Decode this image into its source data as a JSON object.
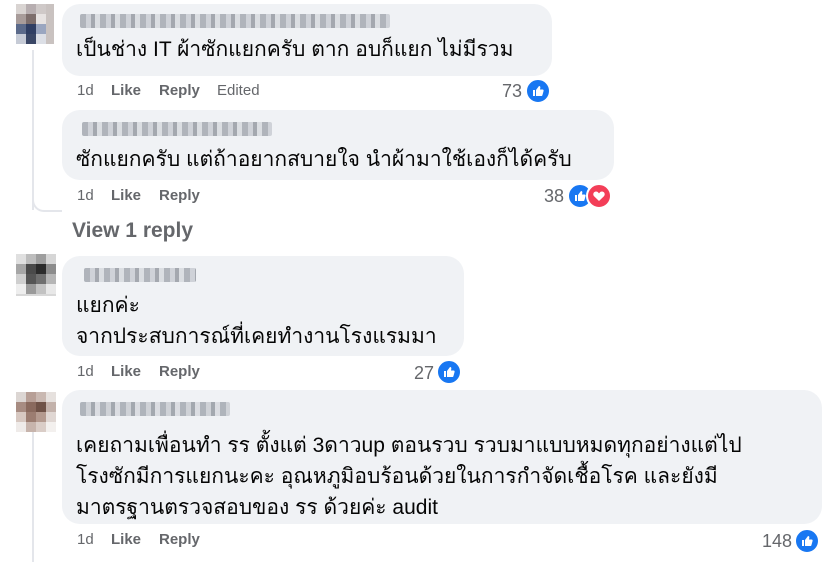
{
  "comments": [
    {
      "text": "เป็นช่าง IT ผ้าซักแยกครับ ตาก อบก็แยก ไม่มีรวม",
      "time": "1d",
      "like": "Like",
      "reply": "Reply",
      "edited": "Edited",
      "count": "73",
      "reactions": [
        "like-icon"
      ]
    },
    {
      "text": "ซักแยกครับ แต่ถ้าอยากสบายใจ นำผ้ามาใช้เองก็ได้ครับ",
      "time": "1d",
      "like": "Like",
      "reply": "Reply",
      "count": "38",
      "reactions": [
        "like-icon",
        "heart-icon"
      ]
    },
    {
      "text": "แยกค่ะ\nจากประสบการณ์ที่เคยทำงานโรงแรมมา",
      "time": "1d",
      "like": "Like",
      "reply": "Reply",
      "count": "27",
      "reactions": [
        "like-icon"
      ]
    },
    {
      "text": "เคยถามเพื่อนทำ รร ตั้งแต่ 3ดาวup ตอนรวบ รวบมาแบบหมดทุกอย่างแต่ไป\nโรงซักมีการแยกนะคะ อุณหภูมิอบร้อนด้วยในการกำจัดเชื้อโรค และยังมี\nมาตรฐานตรวจสอบของ รร ด้วยค่ะ audit",
      "time": "1d",
      "like": "Like",
      "reply": "Reply",
      "count": "148",
      "reactions": [
        "like-icon"
      ]
    }
  ],
  "view_replies": "View 1 reply",
  "colors": {
    "bubble": "#f0f2f5",
    "meta": "#65676b",
    "like_blue": "#1877f2",
    "love_red": "#f33e58"
  }
}
